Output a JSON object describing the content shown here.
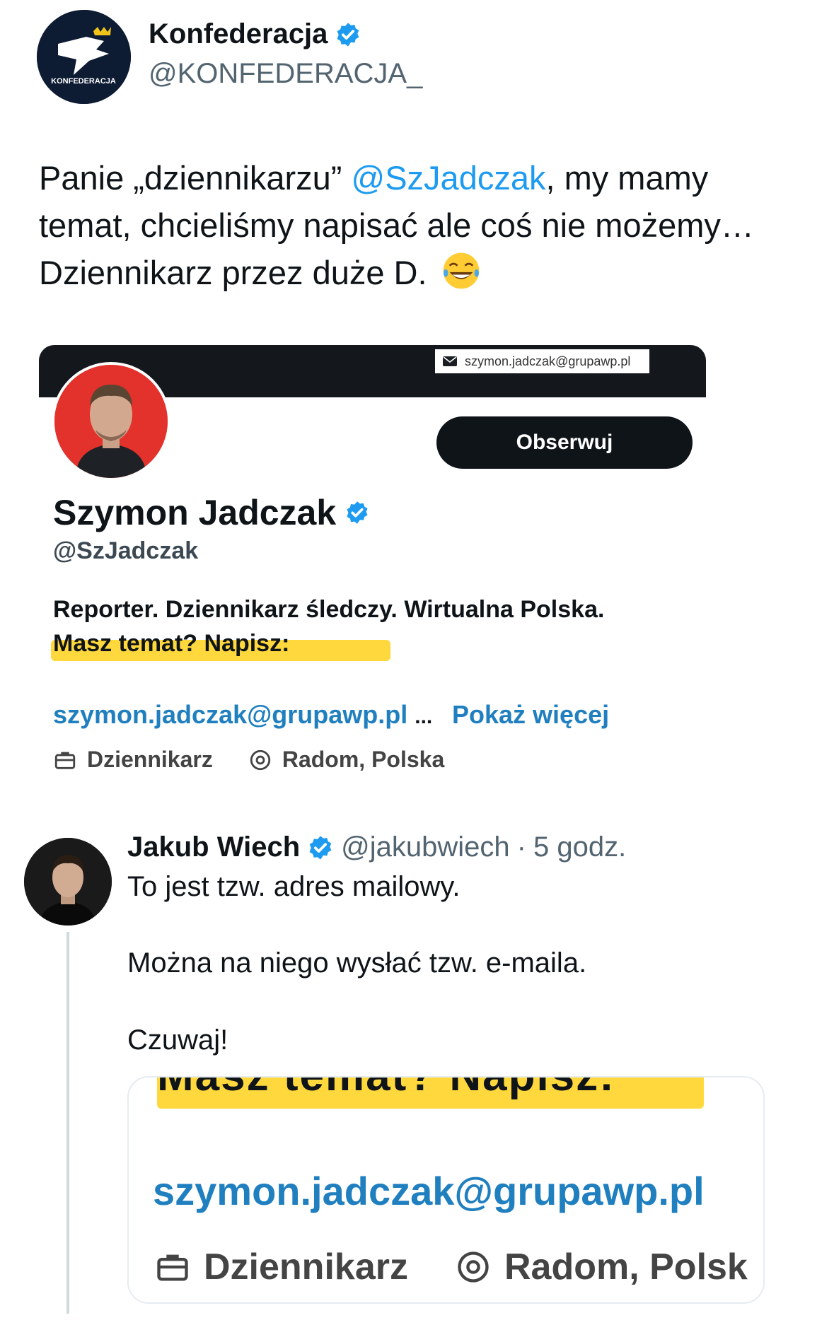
{
  "author": {
    "name": "Konfederacja",
    "handle": "@KONFEDERACJA_",
    "logo_text": "KONFEDERACJA",
    "verified": true
  },
  "tweet": {
    "text_before": "Panie „dziennikarzu” ",
    "mention": "@SzJadczak",
    "text_line1_after": ", my mamy",
    "line2": "temat, chcieliśmy napisać ale coś nie możemy…",
    "line3": "Dziennikarz przez duże D.",
    "emoji": "face-with-tears-of-joy"
  },
  "profile_screenshot": {
    "banner_email": "szymon.jadczak@grupawp.pl",
    "follow_label": "Obserwuj",
    "name": "Szymon Jadczak",
    "handle": "@SzJadczak",
    "bio_line1": "Reporter. Dziennikarz śledczy. Wirtualna Polska.",
    "bio_line2": "Masz temat? Napisz:",
    "link": "szymon.jadczak@grupawp.pl",
    "ellipsis": "...",
    "show_more": "Pokaż więcej",
    "profession": "Dziennikarz",
    "location": "Radom, Polska"
  },
  "reply": {
    "name": "Jakub Wiech",
    "handle": "@jakubwiech",
    "separator": "·",
    "time": "5 godz.",
    "line1": "To jest tzw. adres mailowy.",
    "line2": "Można na niego wysłać tzw. e-maila.",
    "line3": "Czuwaj!",
    "media": {
      "cut_text": "Masz temat? Napisz:",
      "email": "szymon.jadczak@grupawp.pl",
      "profession": "Dziennikarz",
      "location": "Radom, Polsk"
    }
  },
  "colors": {
    "accent": "#1d9bf0",
    "link": "#1f7fbf",
    "highlight": "#ffd83d",
    "banner": "#14171c",
    "profile_bg": "#e3312b"
  }
}
